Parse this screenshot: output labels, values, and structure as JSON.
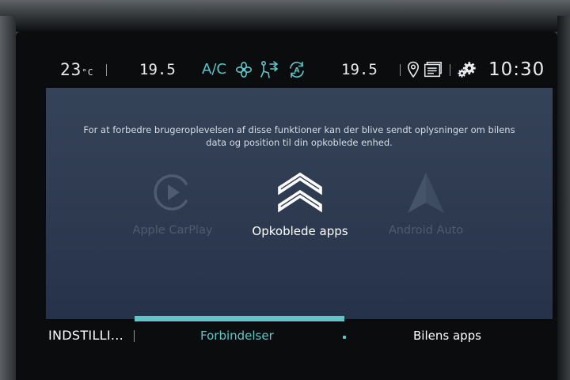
{
  "status_bar": {
    "outside_temp": "23",
    "outside_temp_unit": "°C",
    "left_temp": "19.5",
    "ac_label": "A/C",
    "right_temp": "19.5",
    "clock": "10:30",
    "icons": [
      "fan-icon",
      "air-distribution-icon",
      "auto-recirculation-icon",
      "navigation-pin-icon",
      "messages-icon",
      "settings-icon"
    ],
    "accent_color": "#5fc6c8"
  },
  "main": {
    "info_line1": "For at forbedre brugeroplevelsen af disse funktioner kan der blive sendt oplysninger om bilens",
    "info_line2": "data og position til din opkoblede enhed.",
    "apps": [
      {
        "label": "Apple CarPlay",
        "icon": "carplay-play-icon",
        "state": "disabled"
      },
      {
        "label": "Opkoblede apps",
        "icon": "citroen-chevrons-icon",
        "state": "enabled"
      },
      {
        "label": "Android Auto",
        "icon": "android-auto-arrow-icon",
        "state": "disabled"
      }
    ]
  },
  "bottom_nav": {
    "settings_label": "INDSTILLI...",
    "connections_label": "Forbindelser",
    "apps_label": "Bilens apps",
    "active_tab": "Forbindelser"
  }
}
